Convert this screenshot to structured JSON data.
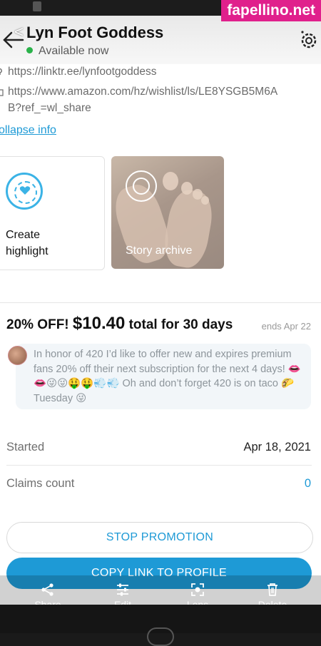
{
  "watermark": "fapellino.net",
  "header": {
    "name": "Lyn Foot Goddess",
    "status": "Available now"
  },
  "links": [
    {
      "text": "https://linktr.ee/lynfootgoddess"
    },
    {
      "text": "https://www.amazon.com/hz/wishlist/ls/LE8YSGB5M6A"
    },
    {
      "text": "B?ref_=wl_share"
    }
  ],
  "collapse_label": "ollapse info",
  "cards": {
    "create": {
      "label_line1": "Create",
      "label_line2": "highlight"
    },
    "archive": {
      "label": "Story archive"
    }
  },
  "promotion": {
    "discount": "20% OFF!",
    "price": "$10.40",
    "period": "total for 30 days",
    "ends": "ends Apr 22",
    "message": "In honor of 420 I’d like to offer new and expires premium fans 20% off their next subscription for the next 4 days! 👄👄😜😜🤑🤑💨💨 Oh and don’t forget 420 is on taco 🌮 Tuesday 😜"
  },
  "details": {
    "started_label": "Started",
    "started_value": "Apr 18, 2021",
    "claims_label": "Claims count",
    "claims_value": "0"
  },
  "buttons": {
    "stop": "STOP PROMOTION",
    "copy": "COPY LINK TO PROFILE"
  },
  "overlay": {
    "share": "Share",
    "edit": "Edit",
    "lens": "Lens",
    "delete": "Delete"
  },
  "colors": {
    "accent": "#1e9ad6",
    "online": "#2ab24a",
    "watermark_bg": "#e0208c"
  }
}
